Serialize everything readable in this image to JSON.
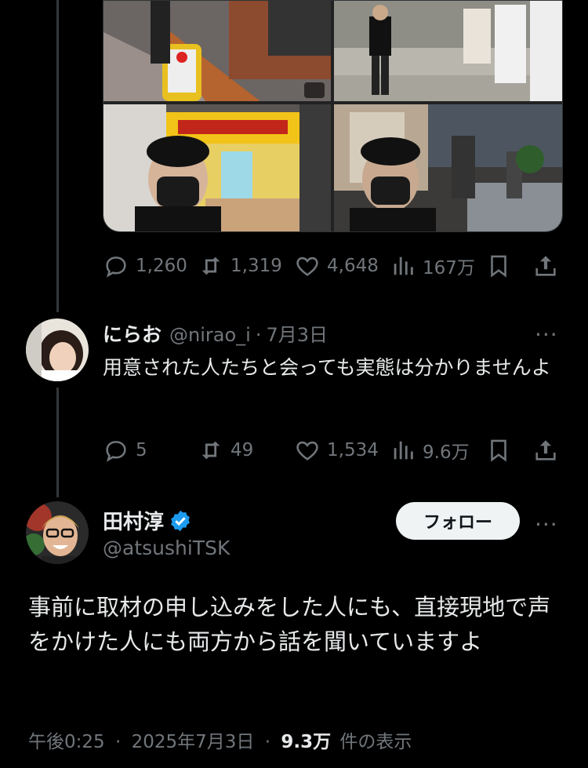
{
  "post1": {
    "stats": {
      "replies": "1,260",
      "reposts": "1,319",
      "likes": "4,648",
      "views": "167万"
    }
  },
  "reply": {
    "display_name": "にらお",
    "handle": "@nirao_i",
    "separator": "·",
    "date": "7月3日",
    "more": "···",
    "text": "用意された人たちと会っても実態は分かりませんよ",
    "stats": {
      "replies": "5",
      "reposts": "49",
      "likes": "1,534",
      "views": "9.6万"
    }
  },
  "main_post": {
    "display_name": "田村淳",
    "handle": "@atsushiTSK",
    "follow_label": "フォロー",
    "more": "···",
    "text": "事前に取材の申し込みをした人にも、直接現地で声をかけた人にも両方から話を聞いていますよ",
    "time": "午後0:25",
    "separator": "·",
    "date": "2025年7月3日",
    "views_count": "9.3万",
    "views_label": "件の表示"
  },
  "colors": {
    "bg": "#000000",
    "text": "#e7e9ea",
    "muted": "#71767b",
    "verified": "#1d9bf0",
    "storefront": "#f2c318"
  },
  "icons": [
    "reply-icon",
    "repost-icon",
    "like-icon",
    "views-icon",
    "bookmark-icon",
    "share-icon",
    "verified-badge-icon",
    "more-icon"
  ]
}
